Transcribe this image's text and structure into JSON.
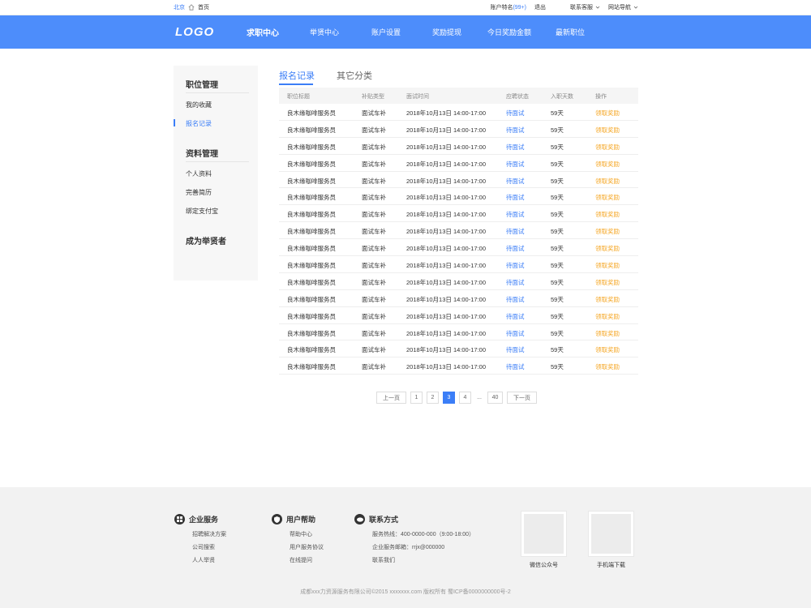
{
  "topbar": {
    "city": "北京",
    "home": "首页",
    "account": "账户特名",
    "badge": "(99+)",
    "logout": "退出",
    "service": "联系客服",
    "sitenav": "网站导航"
  },
  "nav": {
    "logo": "LOGO",
    "items": [
      "求职中心",
      "举贤中心",
      "账户设置",
      "奖励提现",
      "今日奖励金额",
      "最新职位"
    ]
  },
  "sidebar": {
    "group1": "职位管理",
    "g1_items": [
      "我的收藏",
      "报名记录"
    ],
    "group2": "资料管理",
    "g2_items": [
      "个人资料",
      "完善简历",
      "绑定支付宝"
    ],
    "group3": "成为举贤者"
  },
  "tabs": [
    "报名记录",
    "其它分类"
  ],
  "table": {
    "headers": [
      "职位标题",
      "补贴类型",
      "面试时间",
      "应聘状态",
      "入职天数",
      "操作"
    ],
    "rows": [
      [
        "良木缘咖啡服务员",
        "面试车补",
        "2018年10月13日 14:00-17:00",
        "待面试",
        "59天",
        "领取奖励"
      ],
      [
        "良木缘咖啡服务员",
        "面试车补",
        "2018年10月13日 14:00-17:00",
        "待面试",
        "59天",
        "领取奖励"
      ],
      [
        "良木缘咖啡服务员",
        "面试车补",
        "2018年10月13日 14:00-17:00",
        "待面试",
        "59天",
        "领取奖励"
      ],
      [
        "良木缘咖啡服务员",
        "面试车补",
        "2018年10月13日 14:00-17:00",
        "待面试",
        "59天",
        "领取奖励"
      ],
      [
        "良木缘咖啡服务员",
        "面试车补",
        "2018年10月13日 14:00-17:00",
        "待面试",
        "59天",
        "领取奖励"
      ],
      [
        "良木缘咖啡服务员",
        "面试车补",
        "2018年10月13日 14:00-17:00",
        "待面试",
        "59天",
        "领取奖励"
      ],
      [
        "良木缘咖啡服务员",
        "面试车补",
        "2018年10月13日 14:00-17:00",
        "待面试",
        "59天",
        "领取奖励"
      ],
      [
        "良木缘咖啡服务员",
        "面试车补",
        "2018年10月13日 14:00-17:00",
        "待面试",
        "59天",
        "领取奖励"
      ],
      [
        "良木缘咖啡服务员",
        "面试车补",
        "2018年10月13日 14:00-17:00",
        "待面试",
        "59天",
        "领取奖励"
      ],
      [
        "良木缘咖啡服务员",
        "面试车补",
        "2018年10月13日 14:00-17:00",
        "待面试",
        "59天",
        "领取奖励"
      ],
      [
        "良木缘咖啡服务员",
        "面试车补",
        "2018年10月13日 14:00-17:00",
        "待面试",
        "59天",
        "领取奖励"
      ],
      [
        "良木缘咖啡服务员",
        "面试车补",
        "2018年10月13日 14:00-17:00",
        "待面试",
        "59天",
        "领取奖励"
      ],
      [
        "良木缘咖啡服务员",
        "面试车补",
        "2018年10月13日 14:00-17:00",
        "待面试",
        "59天",
        "领取奖励"
      ],
      [
        "良木缘咖啡服务员",
        "面试车补",
        "2018年10月13日 14:00-17:00",
        "待面试",
        "59天",
        "领取奖励"
      ],
      [
        "良木缘咖啡服务员",
        "面试车补",
        "2018年10月13日 14:00-17:00",
        "待面试",
        "59天",
        "领取奖励"
      ],
      [
        "良木缘咖啡服务员",
        "面试车补",
        "2018年10月13日 14:00-17:00",
        "待面试",
        "59天",
        "领取奖励"
      ]
    ]
  },
  "pagination": {
    "prev": "上一页",
    "pages": [
      "1",
      "2",
      "3",
      "4"
    ],
    "current": "3",
    "dots": "...",
    "last": "40",
    "next": "下一页"
  },
  "footer": {
    "col1": {
      "title": "企业服务",
      "links": [
        "招聘解决方案",
        "公司搜索",
        "人人举贤"
      ]
    },
    "col2": {
      "title": "用户帮助",
      "links": [
        "帮助中心",
        "用户服务协议",
        "在线提问"
      ]
    },
    "col3": {
      "title": "联系方式",
      "links": [
        "服务热线：400-0000-000（9:00-18:00）",
        "企业服务邮箱：rrjx@000000",
        "联系我们"
      ]
    },
    "qr1": "微信公众号",
    "qr2": "手机端下载",
    "copyright": "成都xxx力资源服务有限公司©2015 xxxxxxx.com   版权所有   蜀ICP备0000000000号-2"
  },
  "colors": {
    "brand": "#4d8dfb",
    "link": "#3b7ef7",
    "action": "#f5a623"
  }
}
